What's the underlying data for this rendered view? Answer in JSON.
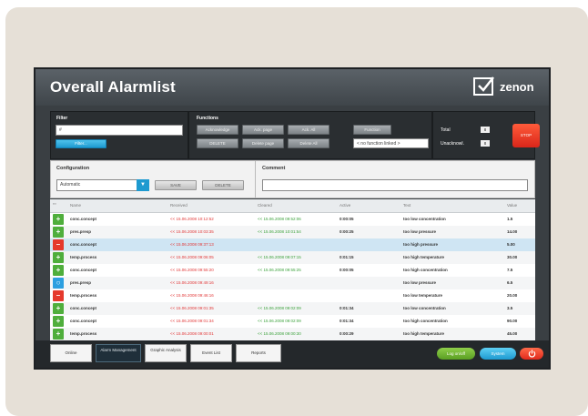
{
  "window": {
    "title": "Overall Alarmlist",
    "brand": "zenon"
  },
  "filter": {
    "label": "Filter",
    "input_value": "#",
    "button": "Filter..."
  },
  "functions": {
    "label": "Functions",
    "buttons": [
      "Acknowledge",
      "Ack. page",
      "Ack. All",
      "DELETE",
      "Delete page",
      "Delete All"
    ],
    "function_button": "Function",
    "select_value": "< no function linked >"
  },
  "counts": {
    "total_label": "Total",
    "total_value": "8",
    "unack_label": "Unacknowl.",
    "unack_value": "8"
  },
  "stop_label": "STOP",
  "configuration": {
    "label": "Configuration",
    "select_value": "Automatic",
    "save": "SAVE",
    "delete": "DELETE"
  },
  "comment": {
    "label": "Comment",
    "value": ""
  },
  "table": {
    "headers": [
      "Name",
      "Received",
      "Cleared",
      "Active",
      "Text",
      "Value"
    ],
    "rows": [
      {
        "status": "+",
        "name": "conc.concept",
        "received": "<< 15.06.2008 10:12:52",
        "cleared": "<< 15.06.2008 09:52:06",
        "active": "0:00:05",
        "text": "too low concentration",
        "value": "1.5",
        "hl": false
      },
      {
        "status": "+",
        "name": "pres.presp",
        "received": "<< 15.06.2008 10:03:35",
        "cleared": "<< 15.06.2008 10:01:54",
        "active": "0:00:25",
        "text": "too low pressure",
        "value": "14.00",
        "hl": false
      },
      {
        "status": "-",
        "name": "conc.concept",
        "received": "<< 15.06.2008 09:37:13",
        "cleared": "",
        "active": "",
        "text": "too high pressure",
        "value": "5.00",
        "hl": true
      },
      {
        "status": "+",
        "name": "temp.process",
        "received": "<< 15.06.2008 09:06:05",
        "cleared": "<< 15.06.2008 09:07:15",
        "active": "0:01:15",
        "text": "too high temperature",
        "value": "30.00",
        "hl": false
      },
      {
        "status": "+",
        "name": "conc.concept",
        "received": "<< 15.06.2008 09:55:20",
        "cleared": "<< 15.06.2008 09:55:25",
        "active": "0:00:05",
        "text": "too high concentration",
        "value": "7.5",
        "hl": false
      },
      {
        "status": "o",
        "name": "pres.presp",
        "received": "<< 15.06.2008 09:49:16",
        "cleared": "",
        "active": "",
        "text": "too low pressure",
        "value": "6.5",
        "hl": false
      },
      {
        "status": "-",
        "name": "temp.process",
        "received": "<< 15.06.2008 09:46:16",
        "cleared": "",
        "active": "",
        "text": "too low temperature",
        "value": "20.00",
        "hl": false
      },
      {
        "status": "+",
        "name": "conc.concept",
        "received": "<< 15.06.2008 09:01:35",
        "cleared": "<< 15.06.2008 09:02:09",
        "active": "0:01:34",
        "text": "too low concentration",
        "value": "3.5",
        "hl": false
      },
      {
        "status": "+",
        "name": "conc.concept",
        "received": "<< 15.06.2008 09:01:34",
        "cleared": "<< 15.06.2008 09:02:09",
        "active": "0:01:34",
        "text": "too high concentration",
        "value": "90.00",
        "hl": false
      },
      {
        "status": "+",
        "name": "temp.process",
        "received": "<< 15.06.2008 09:00:01",
        "cleared": "<< 15.06.2008 09:00:30",
        "active": "0:00:29",
        "text": "too high temperature",
        "value": "45.00",
        "hl": false
      }
    ]
  },
  "bottom": {
    "tabs": [
      "Online",
      "Alarm Management",
      "Graphic Analysis",
      "Event List",
      "Reports"
    ],
    "active_tab": 1,
    "log_button": "Log on/off",
    "system_button": "System"
  },
  "colors": {
    "accent": "#1e9ad0",
    "alarm": "#e5392c",
    "ok": "#4fae3c"
  }
}
